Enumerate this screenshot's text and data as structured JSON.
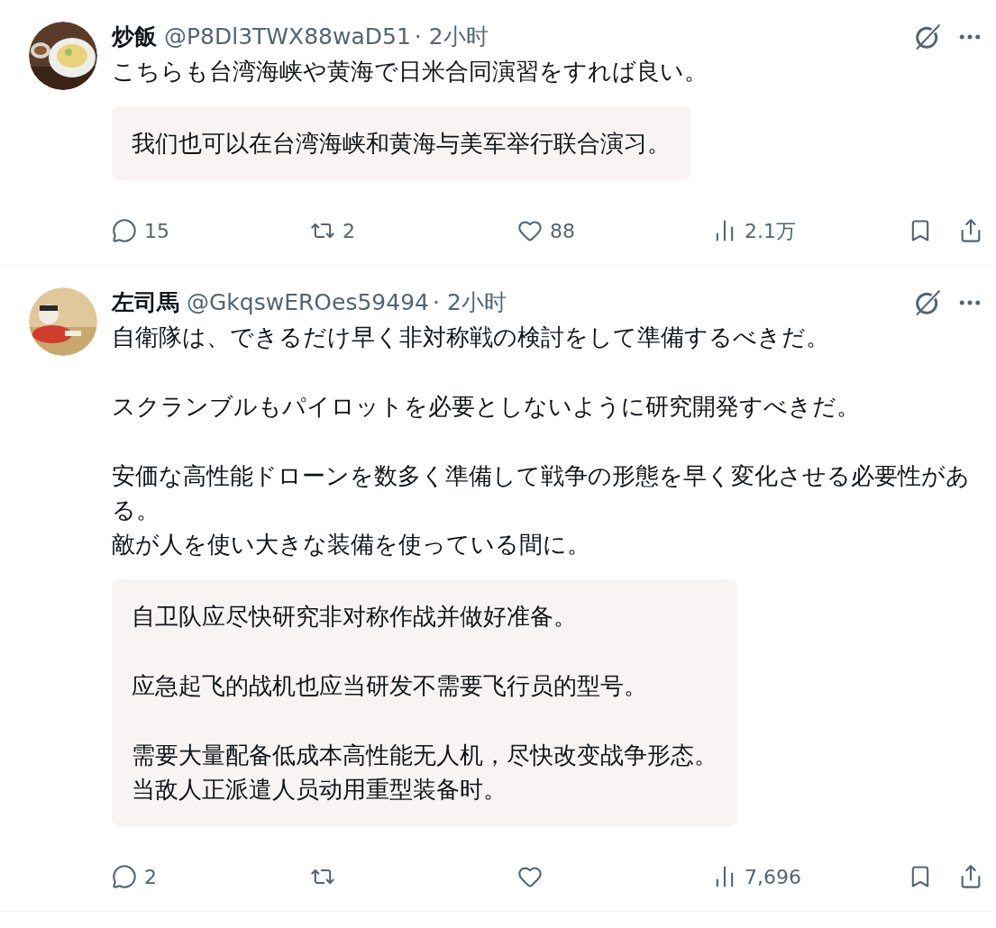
{
  "tweets": [
    {
      "avatar": {
        "kind": "picture"
      },
      "name": "炒飯",
      "handle": "@P8Dl3TWX88waD51",
      "time": "· 2小时",
      "paragraphs": [
        [
          "こちらも台湾海峡や黄海で日米合同演習をすれば良い。"
        ]
      ],
      "translation": [
        [
          "我们也可以在台湾海峡和黄海与美军举行联合演习。"
        ]
      ],
      "replies": "15",
      "reposts": "2",
      "likes": "88",
      "views": "2.1万"
    },
    {
      "avatar": {
        "kind": "picture"
      },
      "name": "左司馬",
      "handle": "@GkqswEROes59494",
      "time": "· 2小时",
      "paragraphs": [
        [
          "自衛隊は、できるだけ早く非対称戦の検討をして準備するべきだ。"
        ],
        [
          "スクランブルもパイロットを必要としないように研究開発すべきだ。"
        ],
        [
          "安価な高性能ドローンを数多く準備して戦争の形態を早く変化させる必要性がある。",
          "敵が人を使い大きな装備を使っている間に。"
        ]
      ],
      "translation": [
        [
          "自卫队应尽快研究非对称作战并做好准备。"
        ],
        [
          "应急起飞的战机也应当研发不需要飞行员的型号。"
        ],
        [
          "需要大量配备低成本高性能无人机，尽快改变战争形态。",
          "当敌人正派遣人员动用重型装备时。"
        ]
      ],
      "replies": "2",
      "views": "7,696"
    }
  ]
}
